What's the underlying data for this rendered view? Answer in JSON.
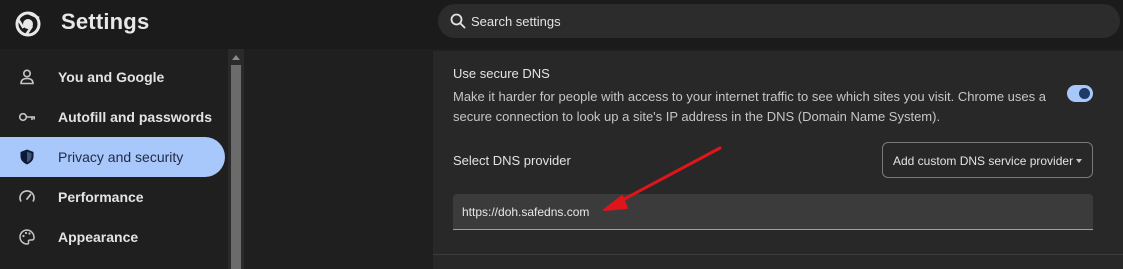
{
  "header": {
    "title": "Settings",
    "logo_icon": "chrome-logo-icon",
    "search": {
      "placeholder": "Search settings",
      "icon": "search-icon"
    }
  },
  "sidebar": {
    "items": [
      {
        "label": "You and Google",
        "icon": "person-icon",
        "active": false
      },
      {
        "label": "Autofill and passwords",
        "icon": "key-icon",
        "active": false
      },
      {
        "label": "Privacy and security",
        "icon": "shield-icon",
        "active": true
      },
      {
        "label": "Performance",
        "icon": "speedometer-icon",
        "active": false
      },
      {
        "label": "Appearance",
        "icon": "palette-icon",
        "active": false
      }
    ]
  },
  "main": {
    "secure_dns": {
      "title": "Use secure DNS",
      "description": "Make it harder for people with access to your internet traffic to see which sites you visit. Chrome uses a secure connection to look up a site's IP address in the DNS (Domain Name System).",
      "enabled": true
    },
    "provider": {
      "label": "Select DNS provider",
      "selected": "Add custom DNS service provider"
    },
    "custom_provider": {
      "value": "https://doh.safedns.com"
    }
  },
  "colors": {
    "accent": "#a8c7fa",
    "background": "#1f1f1f",
    "card": "#282828",
    "annotation_arrow": "#e0151c"
  }
}
